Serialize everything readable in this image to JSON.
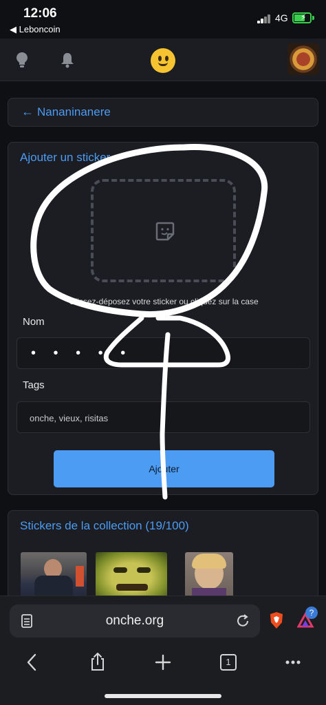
{
  "status": {
    "time": "12:06",
    "back_app": "◀ Leboncoin",
    "network": "4G"
  },
  "nav": {
    "icons": [
      "lightbulb-icon",
      "bell-icon",
      "onche-logo",
      "avatar"
    ]
  },
  "back": {
    "arrow": "←",
    "title": "Nananinanere"
  },
  "form": {
    "title": "Ajouter un sticker",
    "drop_text": "Glissez-déposez votre sticker ou cliquez sur la case",
    "name_label": "Nom",
    "name_value": "• • • • •",
    "tags_label": "Tags",
    "tags_placeholder": "onche, vieux, risitas",
    "submit_label": "Ajouter"
  },
  "collection": {
    "title": "Stickers de la collection (19/100)"
  },
  "browser": {
    "url": "onche.org",
    "tab_count": "1",
    "brave_badge": "?",
    "accent": "#4c9cf3"
  }
}
